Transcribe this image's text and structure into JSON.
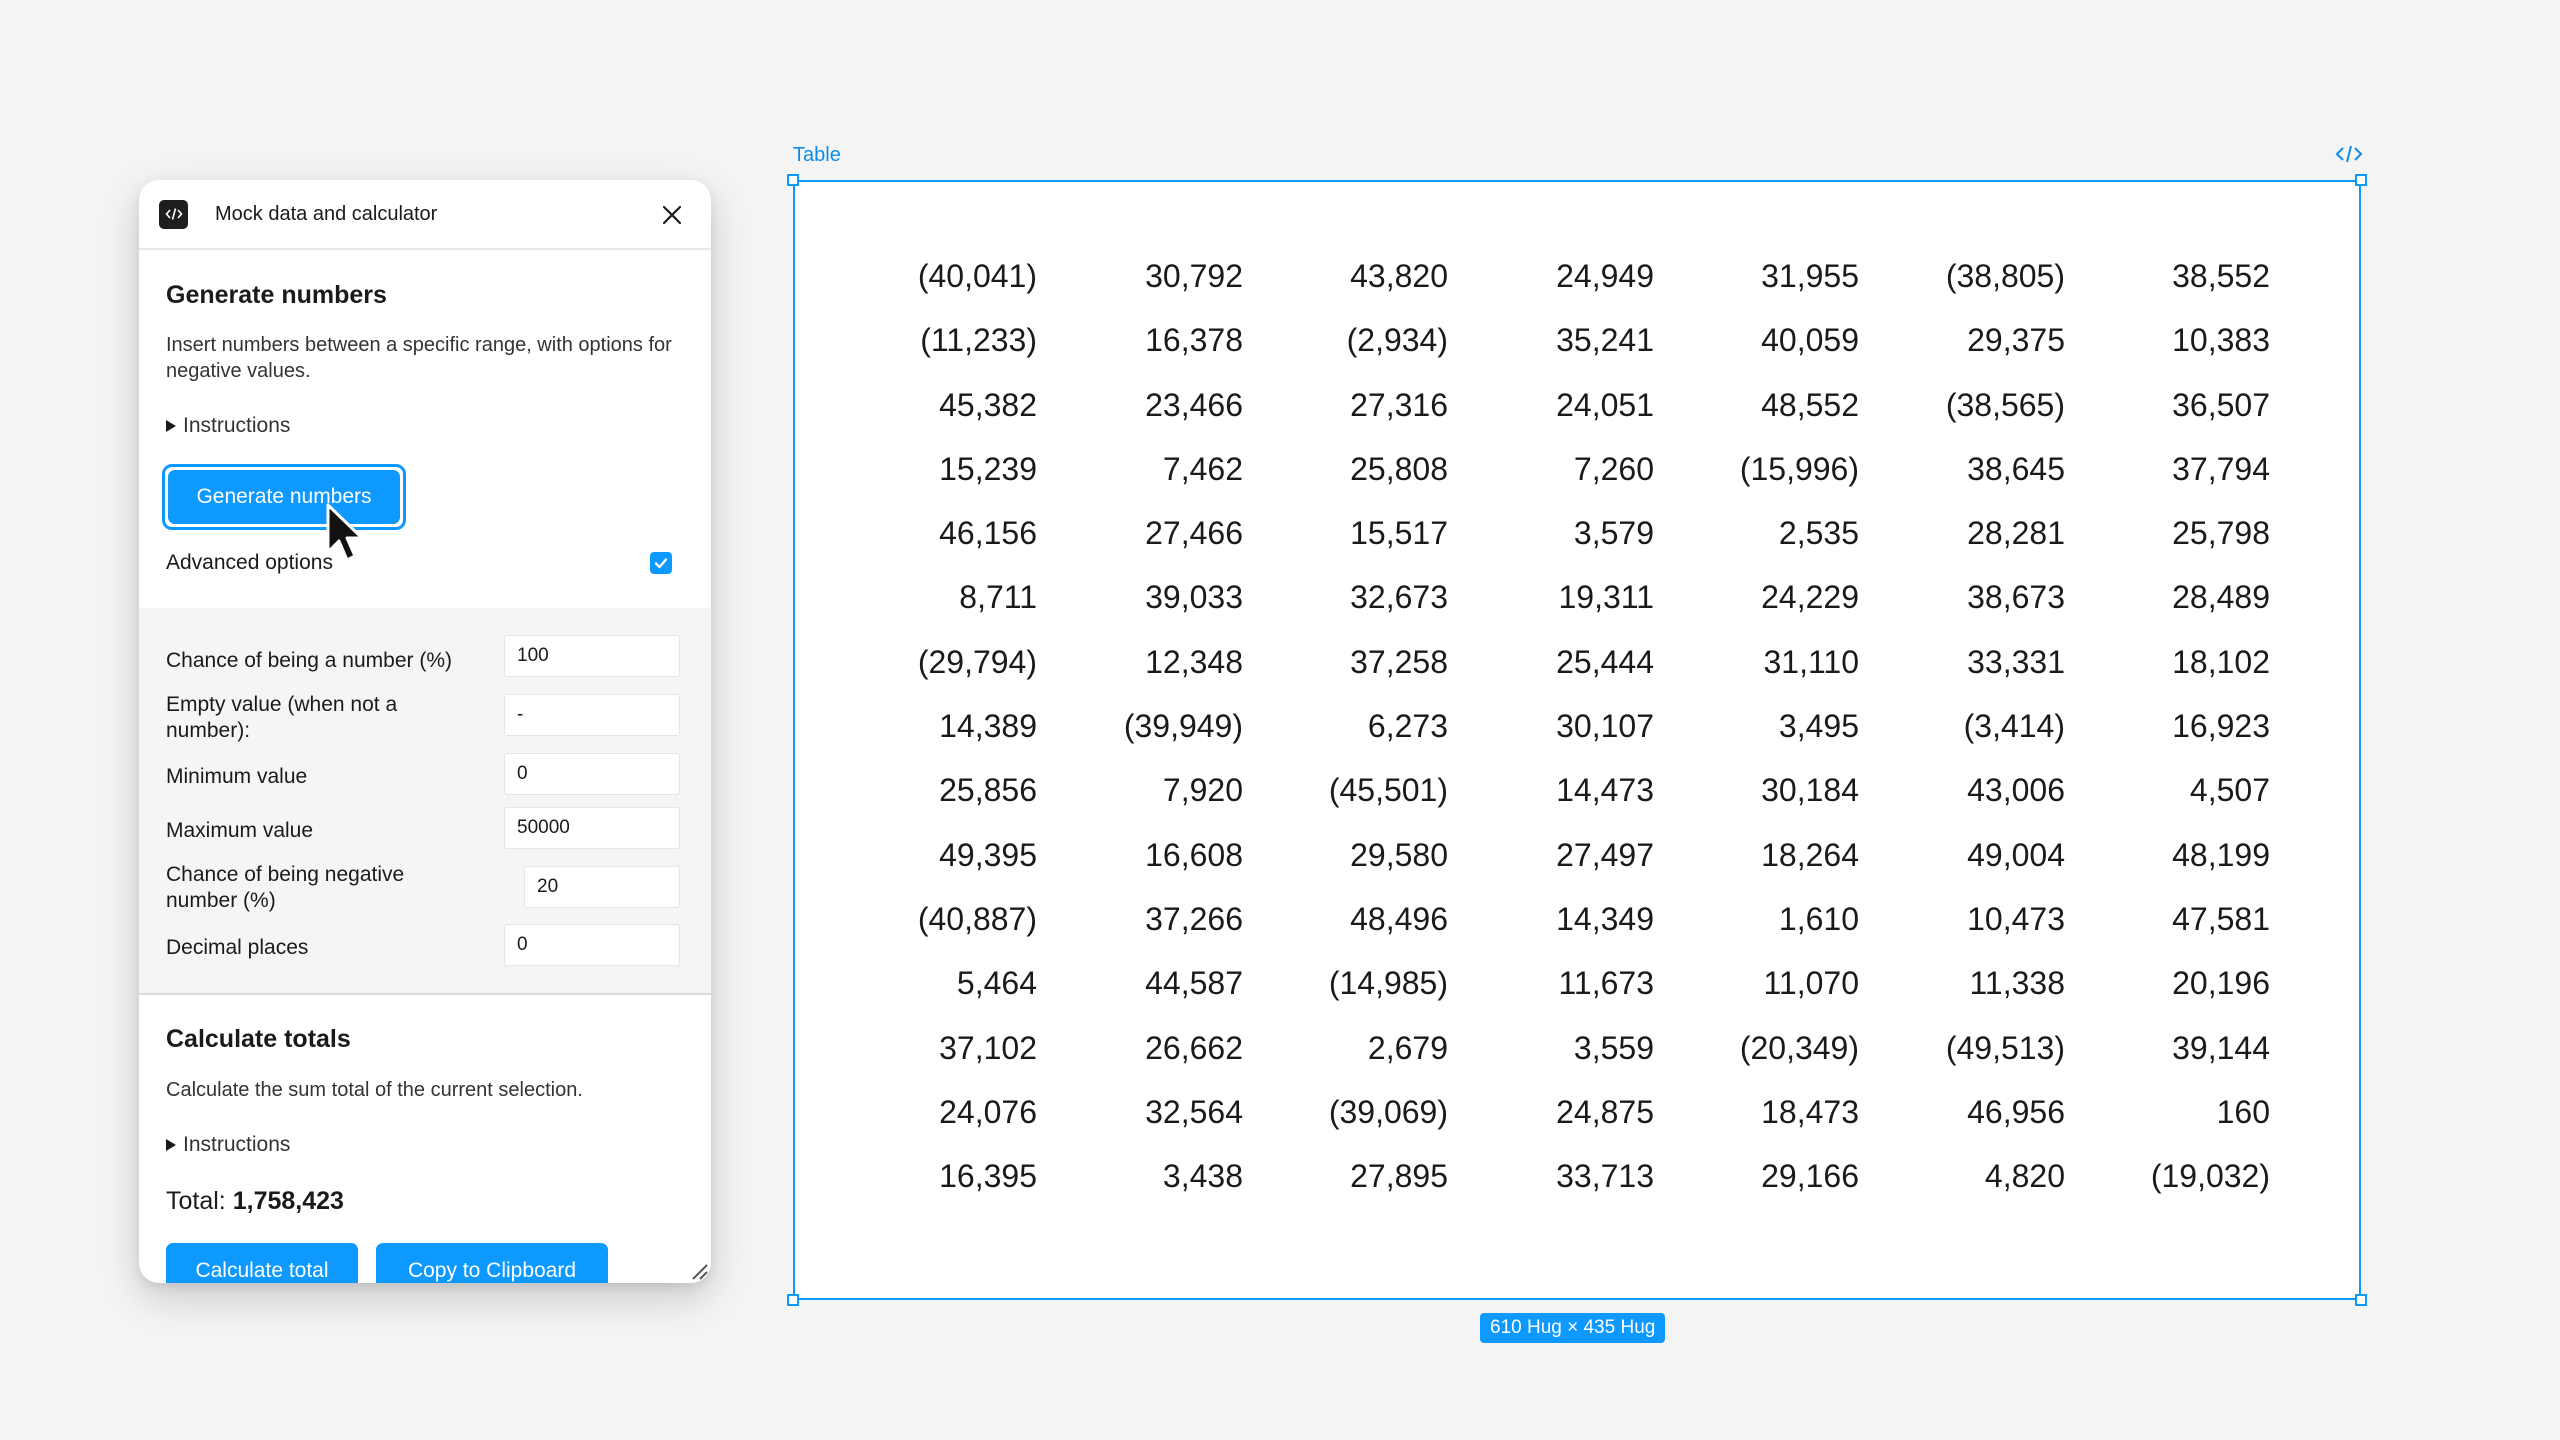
{
  "panel": {
    "title": "Mock data and calculator",
    "plugin_icon": "code-icon",
    "generate": {
      "heading": "Generate numbers",
      "description": "Insert numbers between a specific range, with options for negative values.",
      "instructions_label": "Instructions",
      "button_label": "Generate numbers"
    },
    "advanced_label": "Advanced options",
    "advanced_checked": true,
    "fields": [
      {
        "label": "Chance of being a number (%)",
        "value": "100"
      },
      {
        "label": "Empty value (when not a number):",
        "value": "-"
      },
      {
        "label": "Minimum value",
        "value": "0"
      },
      {
        "label": "Maximum value",
        "value": "50000"
      },
      {
        "label": "Chance of being negative number (%)",
        "value": "20"
      },
      {
        "label": "Decimal places",
        "value": "0"
      }
    ],
    "calc": {
      "heading": "Calculate totals",
      "description": "Calculate the sum total of the current selection.",
      "instructions_label": "Instructions",
      "total_label": "Total:",
      "total_value": "1,758,423",
      "calculate_button": "Calculate total",
      "copy_button": "Copy to Clipboard"
    }
  },
  "frame": {
    "label": "Table",
    "size_badge": "610 Hug × 435 Hug",
    "accent_color": "#0d99ff"
  },
  "table": [
    [
      "(40,041)",
      "30,792",
      "43,820",
      "24,949",
      "31,955",
      "(38,805)",
      "38,552"
    ],
    [
      "(11,233)",
      "16,378",
      "(2,934)",
      "35,241",
      "40,059",
      "29,375",
      "10,383"
    ],
    [
      "45,382",
      "23,466",
      "27,316",
      "24,051",
      "48,552",
      "(38,565)",
      "36,507"
    ],
    [
      "15,239",
      "7,462",
      "25,808",
      "7,260",
      "(15,996)",
      "38,645",
      "37,794"
    ],
    [
      "46,156",
      "27,466",
      "15,517",
      "3,579",
      "2,535",
      "28,281",
      "25,798"
    ],
    [
      "8,711",
      "39,033",
      "32,673",
      "19,311",
      "24,229",
      "38,673",
      "28,489"
    ],
    [
      "(29,794)",
      "12,348",
      "37,258",
      "25,444",
      "31,110",
      "33,331",
      "18,102"
    ],
    [
      "14,389",
      "(39,949)",
      "6,273",
      "30,107",
      "3,495",
      "(3,414)",
      "16,923"
    ],
    [
      "25,856",
      "7,920",
      "(45,501)",
      "14,473",
      "30,184",
      "43,006",
      "4,507"
    ],
    [
      "49,395",
      "16,608",
      "29,580",
      "27,497",
      "18,264",
      "49,004",
      "48,199"
    ],
    [
      "(40,887)",
      "37,266",
      "48,496",
      "14,349",
      "1,610",
      "10,473",
      "47,581"
    ],
    [
      "5,464",
      "44,587",
      "(14,985)",
      "11,673",
      "11,070",
      "11,338",
      "20,196"
    ],
    [
      "37,102",
      "26,662",
      "2,679",
      "3,559",
      "(20,349)",
      "(49,513)",
      "39,144"
    ],
    [
      "24,076",
      "32,564",
      "(39,069)",
      "24,875",
      "18,473",
      "46,956",
      "160"
    ],
    [
      "16,395",
      "3,438",
      "27,895",
      "33,713",
      "29,166",
      "4,820",
      "(19,032)"
    ]
  ]
}
